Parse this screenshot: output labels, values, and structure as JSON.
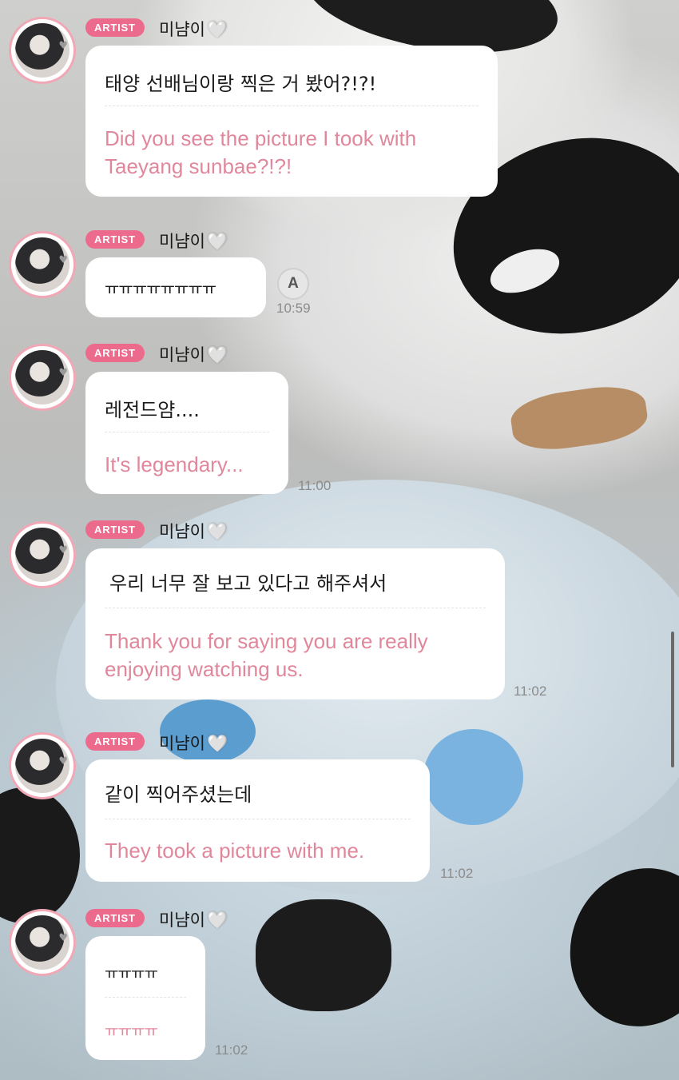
{
  "badge_label": "ARTIST",
  "artist_name": "미냠이",
  "heart_glyph": "🤍",
  "translate_icon_glyph": "A",
  "messages": [
    {
      "ko": "태양 선배님이랑 찍은 거 봤어?!?!",
      "en_lines": [
        "Did you see the picture I took with",
        "Taeyang sunbae?!?!"
      ],
      "time": ""
    },
    {
      "ko": "ㅠㅠㅠㅠㅠㅠㅠㅠ",
      "en_lines": [],
      "time": "10:59"
    },
    {
      "ko": "레전드얌....",
      "en_lines": [
        "It's legendary..."
      ],
      "time": "11:00"
    },
    {
      "ko": "우리 너무 잘 보고 있다고 해주셔서",
      "en_lines": [
        "Thank you for saying you are really",
        "enjoying watching us."
      ],
      "time": "11:02"
    },
    {
      "ko": "같이 찍어주셨는데",
      "en_lines": [
        "They took a picture with me."
      ],
      "time": "11:02"
    },
    {
      "ko": "ㅠㅠㅠㅠ",
      "en_lines": [
        "ㅠㅠㅠㅠ"
      ],
      "time": "11:02"
    }
  ],
  "colors": {
    "badge": "#ec6b8c",
    "translation_text": "#e0879c",
    "bubble": "#ffffff",
    "avatar_ring": "#f1a8b6"
  }
}
